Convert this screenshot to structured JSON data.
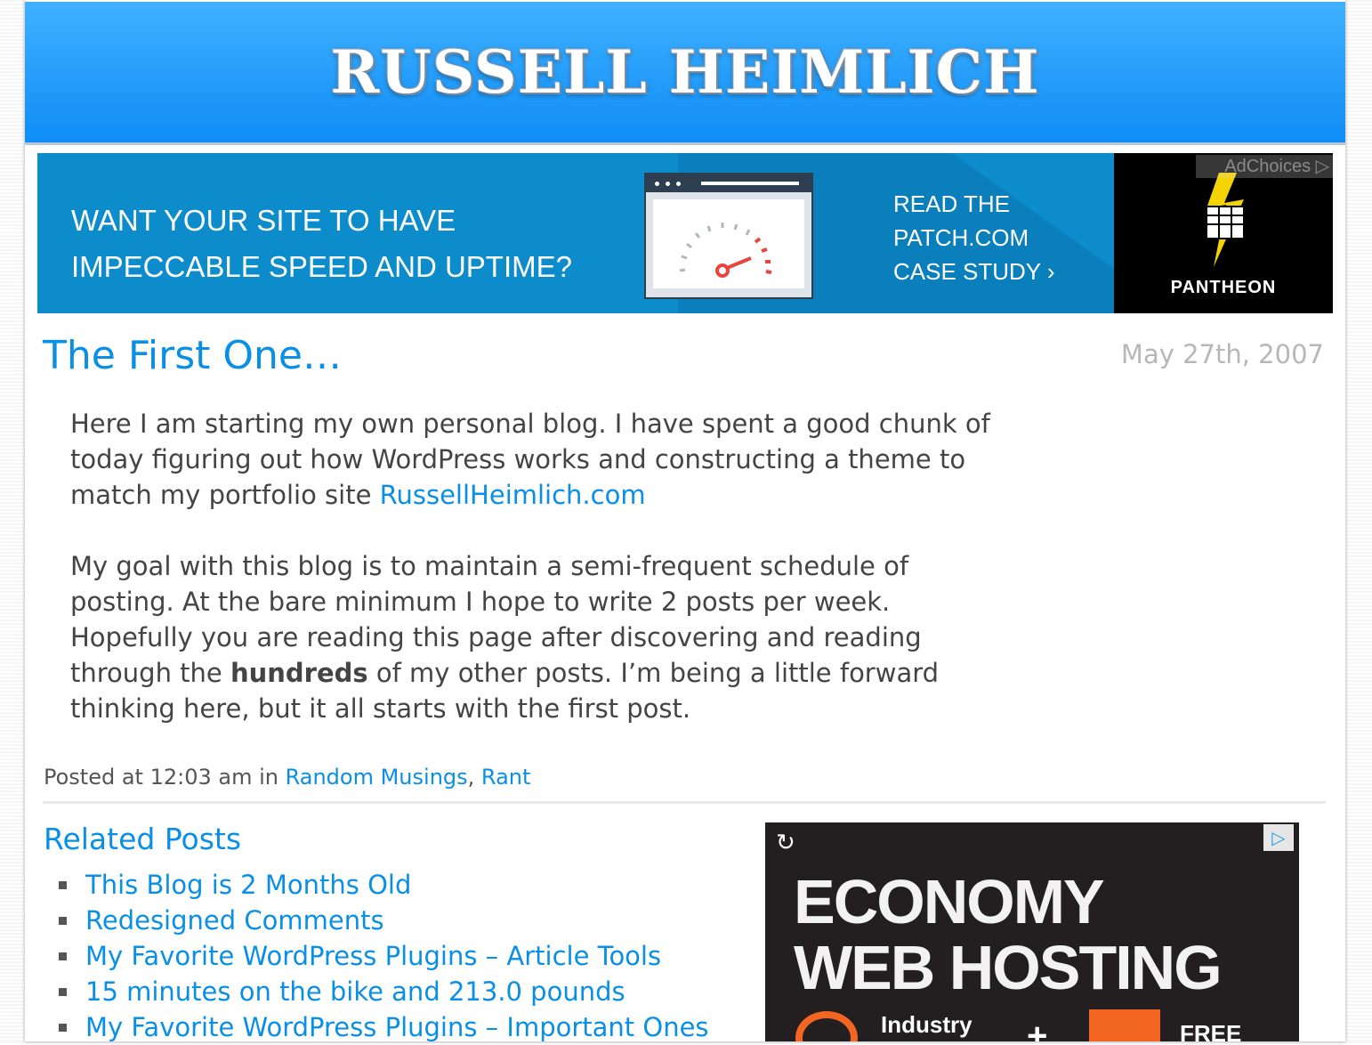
{
  "header": {
    "site_title": "RUSSELL HEIMLICH"
  },
  "top_ad": {
    "headline_line1": "WANT YOUR SITE TO HAVE",
    "headline_line2": "IMPECCABLE SPEED AND UPTIME?",
    "cta_line1": "READ THE",
    "cta_line2": "PATCH.COM",
    "cta_line3": "CASE STUDY ›",
    "brand": "PANTHEON",
    "adchoices": "AdChoices ▷",
    "bg_color": "#0d8ccc"
  },
  "post": {
    "title": "The First One…",
    "date": "May 27th, 2007",
    "para1_text": "Here I am starting my own personal blog. I have spent a good chunk of today figuring out how WordPress works and constructing a theme to match my portfolio site ",
    "para1_link": "RussellHeimlich.com",
    "para2_before": "My goal with this blog is to maintain a semi-frequent schedule of posting. At the bare minimum I hope to write 2 posts per week. Hopefully you are reading this page after discovering and reading through the ",
    "para2_bold": "hundreds",
    "para2_after": " of my other posts. I’m being a little forward thinking here, but it all starts with the first post.",
    "meta_prefix": "Posted at 12:03 am in ",
    "category1": "Random Musings",
    "separator": ",",
    "category2": "Rant"
  },
  "related": {
    "title": "Related Posts",
    "items": [
      {
        "label": "This Blog is 2 Months Old"
      },
      {
        "label": "Redesigned Comments"
      },
      {
        "label": "My Favorite WordPress Plugins – Article Tools"
      },
      {
        "label": "15 minutes on the bike and 213.0 pounds"
      },
      {
        "label": "My Favorite WordPress Plugins – Important Ones"
      }
    ]
  },
  "side_ad": {
    "headline_line1": "ECONOMY",
    "headline_line2": "WEB HOSTING",
    "industry": "Industry",
    "plus": "+",
    "free": "FREE",
    "replay_icon": "replay-icon",
    "info_icon": "adchoices-info-icon"
  },
  "colors": {
    "link": "#0a8fe6",
    "header_top": "#3fb1ff",
    "header_bottom": "#0f8df5",
    "date": "#b7b7b7"
  }
}
